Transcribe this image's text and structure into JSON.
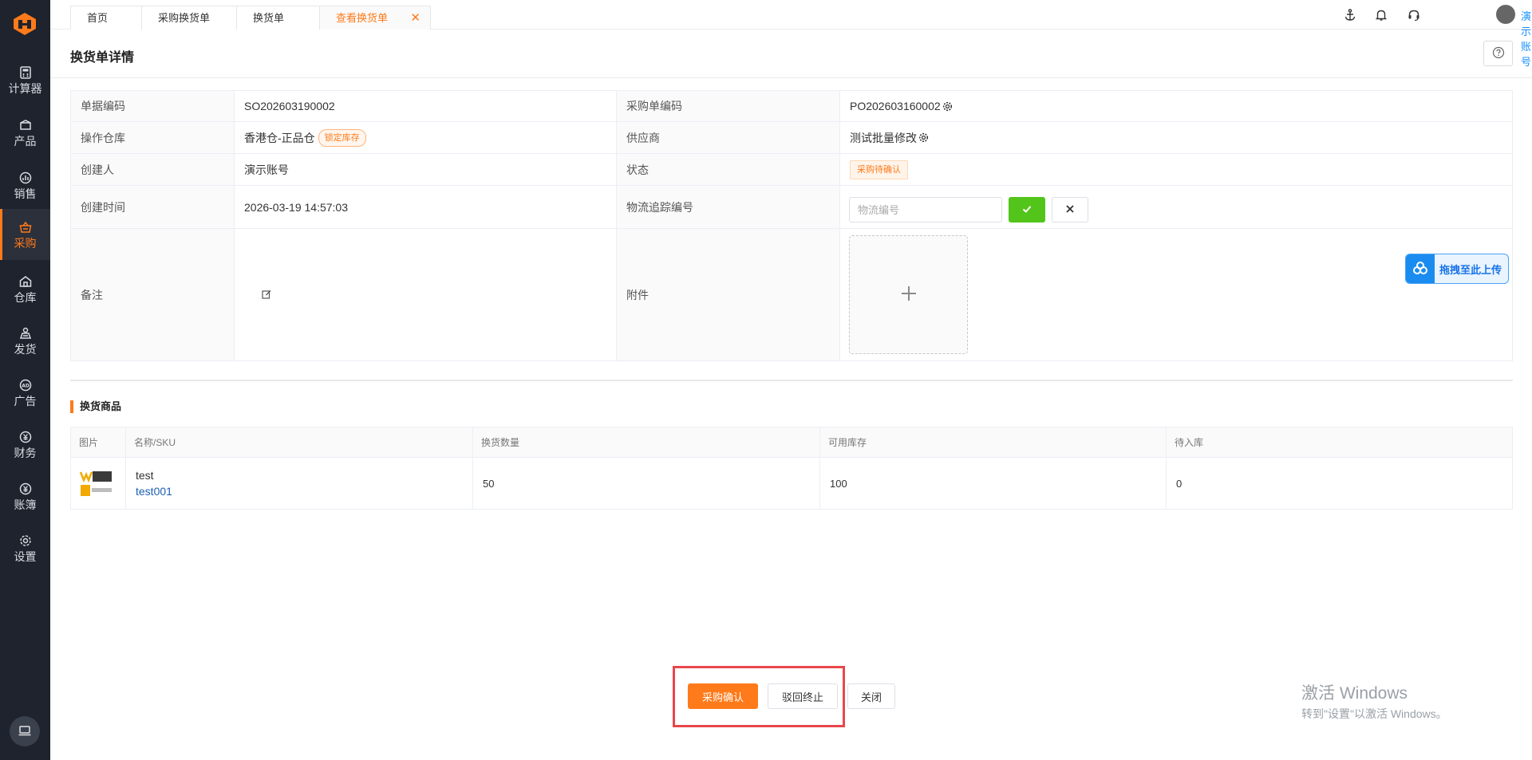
{
  "sidebar": {
    "items": [
      {
        "label": "计算器",
        "icon": "calculator-icon"
      },
      {
        "label": "产品",
        "icon": "box-icon"
      },
      {
        "label": "销售",
        "icon": "chart-icon"
      },
      {
        "label": "采购",
        "icon": "basket-icon",
        "active": true
      },
      {
        "label": "仓库",
        "icon": "warehouse-icon"
      },
      {
        "label": "发货",
        "icon": "truck-icon"
      },
      {
        "label": "广告",
        "icon": "ad-icon"
      },
      {
        "label": "财务",
        "icon": "yuan-icon"
      },
      {
        "label": "账簿",
        "icon": "ledger-icon"
      },
      {
        "label": "设置",
        "icon": "gear-icon"
      }
    ]
  },
  "tabs": [
    {
      "label": "首页"
    },
    {
      "label": "采购换货单"
    },
    {
      "label": "换货单"
    },
    {
      "label": "查看换货单",
      "active": true
    }
  ],
  "topbar": {
    "account": "演示账号"
  },
  "page": {
    "title": "换货单详情"
  },
  "detail": {
    "doc_no_label": "单据编码",
    "doc_no": "SO202603190002",
    "po_no_label": "采购单编码",
    "po_no": "PO202603160002",
    "warehouse_label": "操作仓库",
    "warehouse": "香港仓-正品仓",
    "warehouse_tag": "锁定库存",
    "supplier_label": "供应商",
    "supplier": "测试批量修改",
    "creator_label": "创建人",
    "creator": "演示账号",
    "status_label": "状态",
    "status": "采购待确认",
    "created_label": "创建时间",
    "created": "2026-03-19 14:57:03",
    "tracking_label": "物流追踪编号",
    "tracking_placeholder": "物流编号",
    "tracking_value": "",
    "remark_label": "备注",
    "attachment_label": "附件",
    "drag_upload": "拖拽至此上传"
  },
  "goods": {
    "section_title": "换货商品",
    "headers": [
      "图片",
      "名称/SKU",
      "换货数量",
      "可用库存",
      "待入库"
    ],
    "rows": [
      {
        "name": "test",
        "sku": "test001",
        "qty": "50",
        "stock": "100",
        "pending": "0"
      }
    ]
  },
  "actions": {
    "confirm": "采购确认",
    "reject": "驳回终止",
    "close": "关闭"
  },
  "watermark": {
    "line1": "激活 Windows",
    "line2": "转到\"设置\"以激活 Windows。"
  },
  "colors": {
    "accent": "#ff7a1a",
    "sidebar": "#1e232d",
    "success": "#52c41a",
    "link": "#1a5fb4",
    "highlight": "#e8474c"
  }
}
